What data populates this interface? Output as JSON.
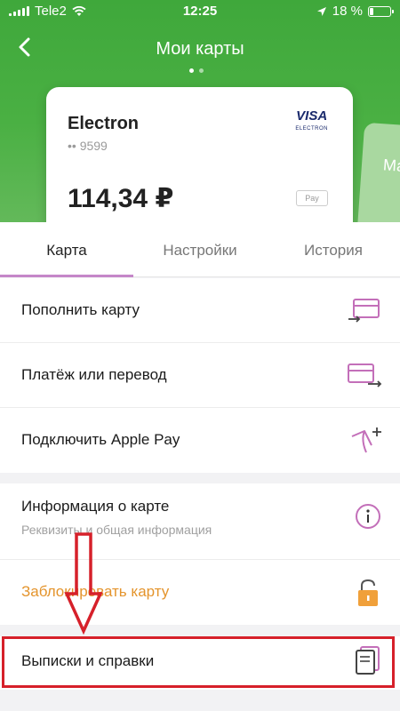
{
  "status_bar": {
    "carrier": "Tele2",
    "time": "12:25",
    "battery_percent": "18 %"
  },
  "nav": {
    "title": "Мои карты",
    "back_icon": "chevron-left-icon"
  },
  "card": {
    "name": "Electron",
    "number": "•• 9599",
    "brand": "VISA",
    "brand_sub": "ELECTRON",
    "balance": "114,34 ₽",
    "wallet_badge": " Pay"
  },
  "next_card_peek": "Ма",
  "tabs": [
    {
      "label": "Карта",
      "active": true
    },
    {
      "label": "Настройки",
      "active": false
    },
    {
      "label": "История",
      "active": false
    }
  ],
  "actions": [
    {
      "label": "Пополнить карту",
      "icon": "card-topup-icon"
    },
    {
      "label": "Платёж или перевод",
      "icon": "card-transfer-icon"
    },
    {
      "label": "Подключить Apple Pay",
      "icon": "apple-pay-add-icon"
    }
  ],
  "info": [
    {
      "label": "Информация о карте",
      "sub": "Реквизиты и общая информация",
      "icon": "info-icon"
    },
    {
      "label": "Заблокировать карту",
      "icon": "lock-icon"
    }
  ],
  "statements": {
    "label": "Выписки и справки",
    "icon": "documents-icon"
  },
  "colors": {
    "header_green": "#4ab043",
    "tab_indicator": "#c587c9",
    "accent_orange": "#e4942c",
    "icon_pink": "#c36fb9",
    "highlight_red": "#d6202a"
  }
}
